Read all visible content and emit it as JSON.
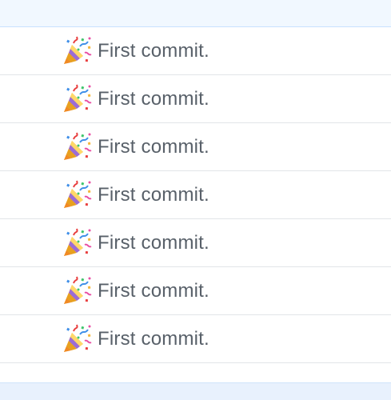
{
  "commits": [
    {
      "icon": "party-popper-icon",
      "message": "First commit."
    },
    {
      "icon": "party-popper-icon",
      "message": "First commit."
    },
    {
      "icon": "party-popper-icon",
      "message": "First commit."
    },
    {
      "icon": "party-popper-icon",
      "message": "First commit."
    },
    {
      "icon": "party-popper-icon",
      "message": "First commit."
    },
    {
      "icon": "party-popper-icon",
      "message": "First commit."
    },
    {
      "icon": "party-popper-icon",
      "message": "First commit."
    }
  ],
  "colors": {
    "header_bg": "#f1f8ff",
    "header_border": "#c8e1ff",
    "row_divider": "#e1e4e8",
    "text": "#586069",
    "footer_bg": "#e8f1fd"
  }
}
